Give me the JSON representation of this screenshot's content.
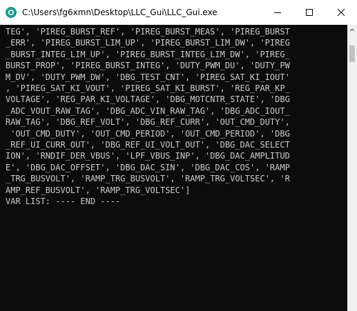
{
  "window": {
    "title": "C:\\Users\\fg6xmn\\Desktop\\LLC_Gui\\LLC_Gui.exe"
  },
  "console": {
    "lines": [
      "TEG', 'PIREG_BURST_REF', 'PIREG_BURST_MEAS', 'PIREG_BURST",
      "_ERR', 'PIREG_BURST_LIM_UP', 'PIREG_BURST_LIM_DW', 'PIREG",
      "_BURST_INTEG_LIM_UP', 'PIREG_BURST_INTEG_LIM_DW', 'PIREG_",
      "BURST_PROP', 'PIREG_BURST_INTEG', 'DUTY_PWM_DU', 'DUTY_PW",
      "M_DV', 'DUTY_PWM_DW', 'DBG_TEST_CNT', 'PIREG_SAT_KI_IOUT'",
      ", 'PIREG_SAT_KI_VOUT', 'PIREG_SAT_KI_BURST', 'REG_PAR_KP_",
      "VOLTAGE', 'REG_PAR_KI_VOLTAGE', 'DBG_MOTCNTR_STATE', 'DBG",
      "_ADC_VOUT_RAW_TAG', 'DBG_ADC_VIN_RAW_TAG', 'DBG_ADC_IOUT_",
      "RAW_TAG', 'DBG_REF_VOLT', 'DBG_REF_CURR', 'OUT_CMD_DUTY',",
      " 'OUT_CMD_DUTY', 'OUT_CMD_PERIOD', 'OUT_CMD_PERIOD', 'DBG",
      "_REF_UI_CURR_OUT', 'DBG_REF_UI_VOLT_OUT', 'DBG_DAC_SELECT",
      "ION', 'RNDIF_DER_VBUS', 'LPF_VBUS_INP', 'DBG_DAC_AMPLITUD",
      "E', 'DBG_DAC_OFFSET', 'DBG_DAC_SIN', 'DBG_DAC_COS', 'RAMP",
      "_TRG_BUSVOLT', 'RAMP_TRG_BUSVOLT', 'RAMP_TRG_VOLTSEC', 'R",
      "AMP_REF_BUSVOLT', 'RAMP_TRG_VOLTSEC']",
      "VAR LIST: ---- END ----"
    ]
  },
  "icons": {
    "app": "console-app-icon",
    "minimize": "minimize-icon",
    "maximize": "maximize-icon",
    "close": "close-icon",
    "scroll_up": "scroll-up-arrow-icon"
  },
  "colors": {
    "console_bg": "#0c0c0c",
    "console_fg": "#cccccc",
    "titlebar_bg": "#ffffff",
    "app_icon": "#1a9a8c"
  }
}
